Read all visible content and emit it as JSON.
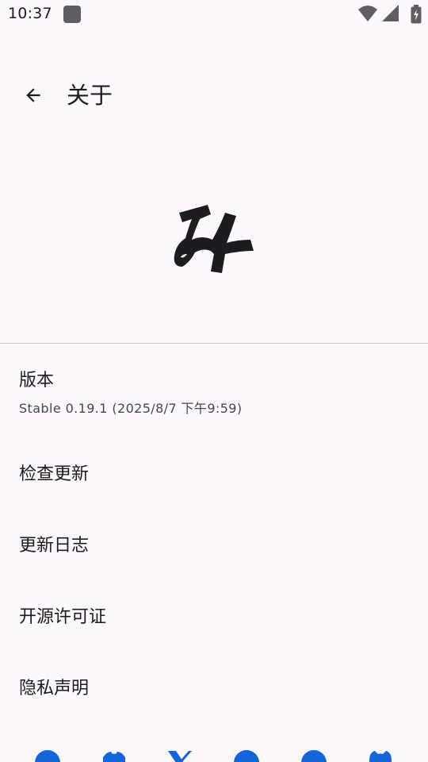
{
  "status_bar": {
    "time": "10:37",
    "icons": [
      "notification-icon",
      "wifi-icon",
      "signal-icon",
      "battery-icon"
    ]
  },
  "top_bar": {
    "back_icon": "arrow-back-icon",
    "title": "关于"
  },
  "logo": {
    "text": "み"
  },
  "items": [
    {
      "title": "版本",
      "subtitle": "Stable 0.19.1 (2025/8/7 下午9:59)"
    },
    {
      "title": "检查更新"
    },
    {
      "title": "更新日志"
    },
    {
      "title": "开源许可证"
    },
    {
      "title": "隐私声明"
    }
  ],
  "social_links": [
    "telegram-icon",
    "discord-icon",
    "x-icon",
    "qq-icon",
    "weibo-icon",
    "github-icon"
  ],
  "colors": {
    "background": "#fcf8fc",
    "text": "#1c1b1f",
    "subtext": "#46464f",
    "divider": "#c9c5ca",
    "social_accent": "#1565d8"
  }
}
